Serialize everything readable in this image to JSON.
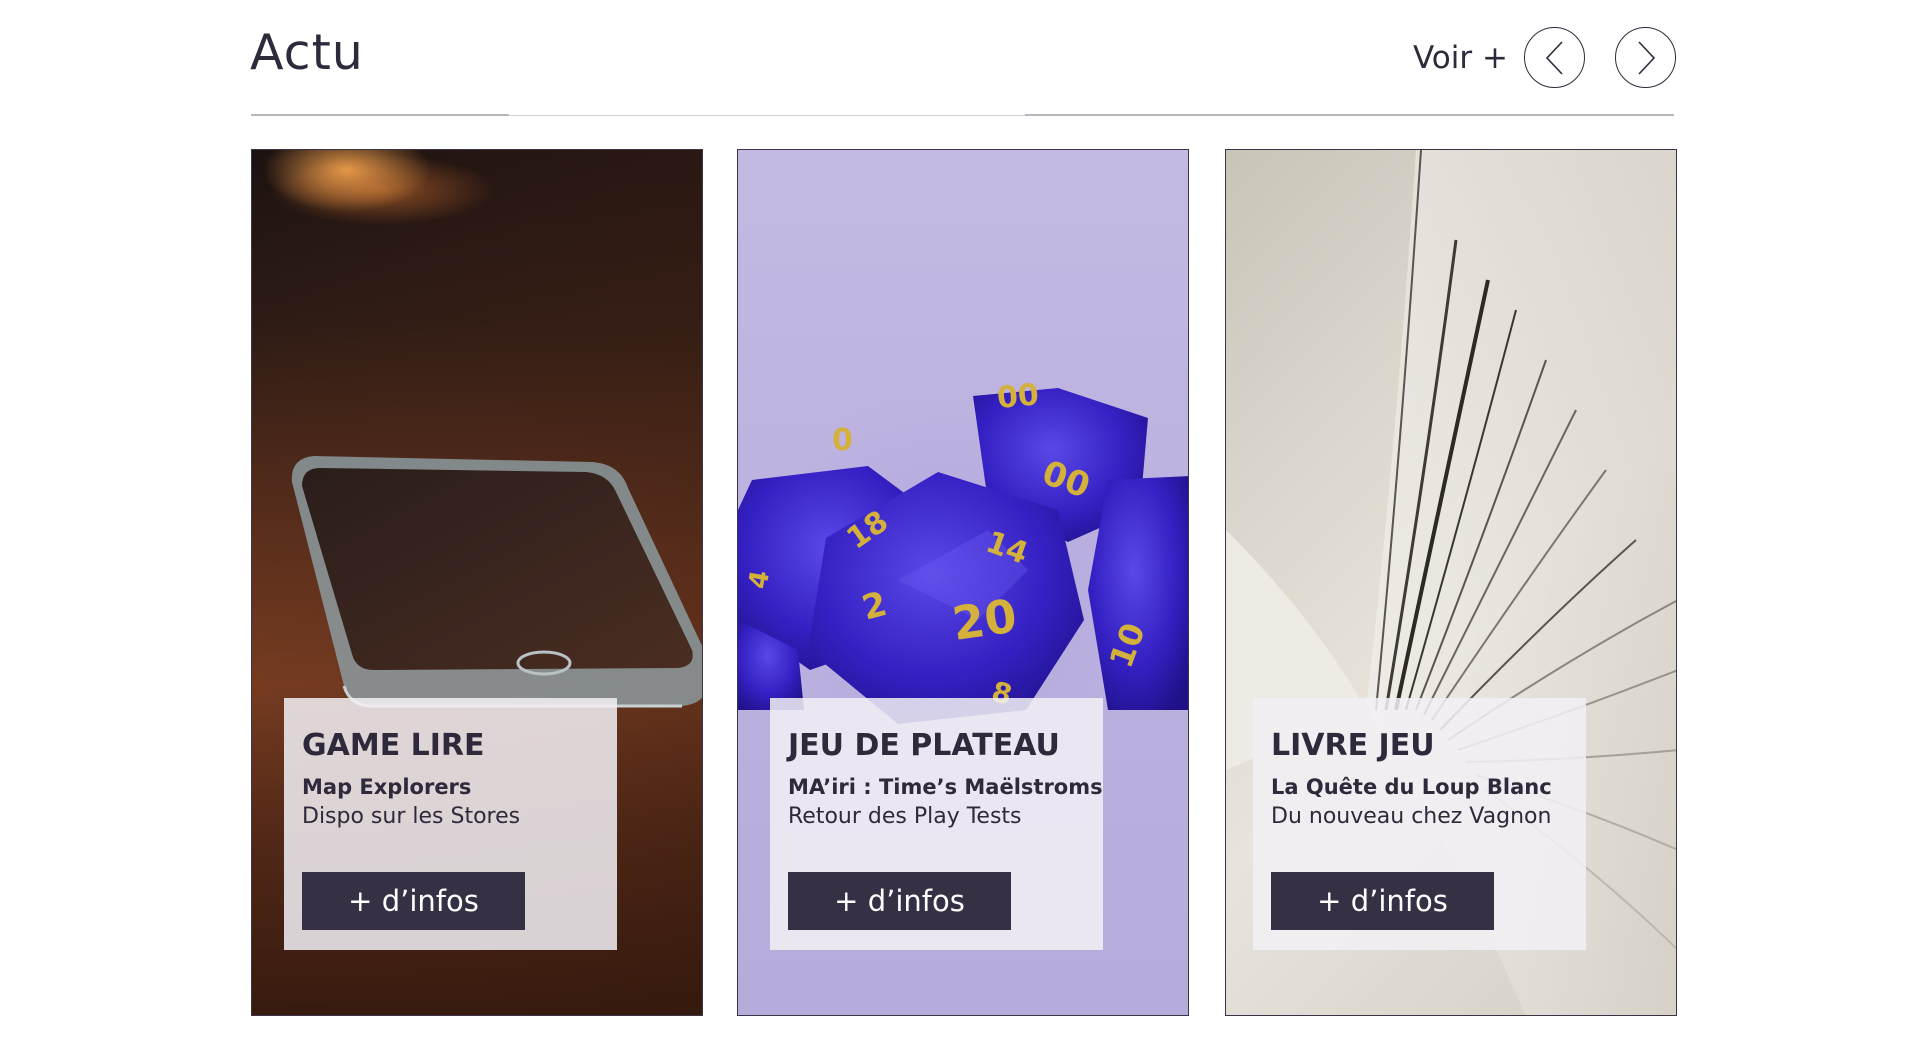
{
  "section": {
    "title": "Actu",
    "see_more": "Voir +",
    "prev_label": "précédent",
    "next_label": "suivant"
  },
  "cards": [
    {
      "category": "GAME LIRE",
      "subtitle": "Map Explorers",
      "description": "Dispo sur les Stores",
      "button": "+ d’infos",
      "image": "smartphone-on-table"
    },
    {
      "category": "JEU DE PLATEAU",
      "subtitle": "MA’iri : Time’s Maëlstroms",
      "description": "Retour des Play Tests",
      "button": "+ d’infos",
      "image": "blue-dice"
    },
    {
      "category": "LIVRE JEU",
      "subtitle": "La Quête du Loup Blanc",
      "description": "Du nouveau chez Vagnon",
      "button": "+ d’infos",
      "image": "open-book-pages"
    }
  ],
  "colors": {
    "text": "#2f2a3b",
    "button_bg": "#353044",
    "dice_bg": "#bdb2e0",
    "dice": "#3b24c9",
    "dice_digits": "#d4b13a"
  }
}
